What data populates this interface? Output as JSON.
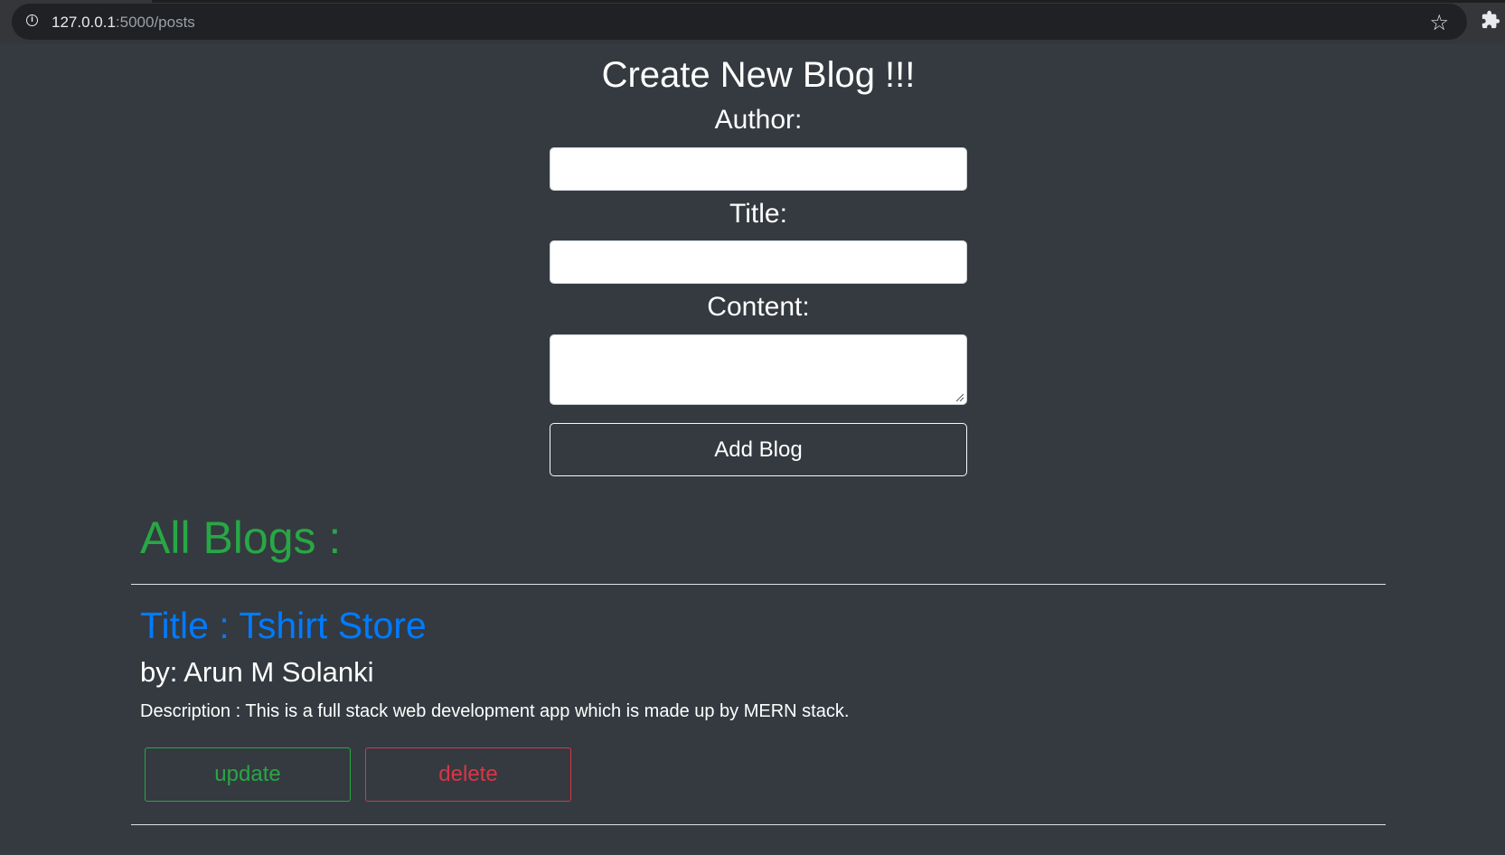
{
  "browser": {
    "url_host": "127.0.0.1",
    "url_path": ":5000/posts"
  },
  "form": {
    "title": "Create New Blog !!!",
    "author_label": "Author:",
    "author_value": "",
    "title_label": "Title:",
    "title_value": "",
    "content_label": "Content:",
    "content_value": "",
    "submit_label": "Add Blog"
  },
  "blogs": {
    "heading": "All Blogs :",
    "items": [
      {
        "title": "Title : Tshirt Store",
        "author": "by: Arun M Solanki",
        "description": "Description : This is a full stack web development app which is made up by MERN stack.",
        "update_label": "update",
        "delete_label": "delete"
      }
    ]
  },
  "colors": {
    "background": "#343a40",
    "success": "#28a745",
    "primary": "#007bff",
    "danger": "#dc3545"
  }
}
